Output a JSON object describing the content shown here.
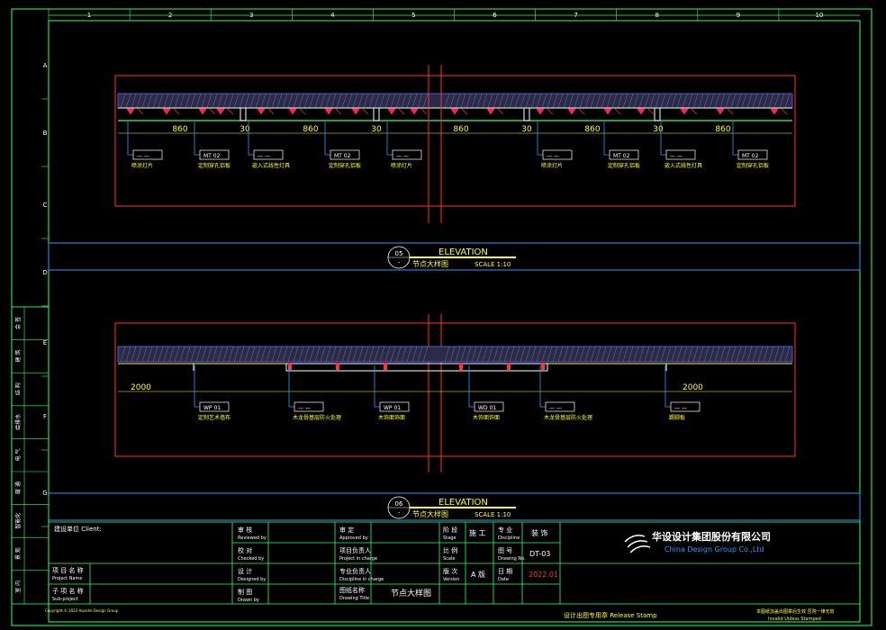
{
  "sheet": {
    "column_labels": [
      "1",
      "2",
      "3",
      "4",
      "5",
      "6",
      "7",
      "8",
      "9",
      "10"
    ],
    "row_labels": [
      "A",
      "B",
      "C",
      "D",
      "E",
      "F",
      "G"
    ]
  },
  "elevation_a": {
    "number": "05",
    "sub": "-",
    "title": "ELEVATION",
    "subtitle": "节点大样图",
    "scale": "SCALE 1:10",
    "dimensions": [
      "860",
      "30",
      "860",
      "30",
      "860",
      "30",
      "860",
      "30",
      "860"
    ],
    "tags": [
      {
        "code": "— —",
        "label": "喷涂灯片"
      },
      {
        "code": "MT 02",
        "label": "定制穿孔铝板"
      },
      {
        "code": "— —",
        "label": "嵌入式线性灯具"
      },
      {
        "code": "MT 02",
        "label": "定制穿孔铝板"
      },
      {
        "code": "— —",
        "label": "喷涂灯片"
      },
      {
        "code": "— —",
        "label": "喷涂灯片"
      },
      {
        "code": "MT 02",
        "label": "定制穿孔铝板"
      },
      {
        "code": "— —",
        "label": "嵌入式线性灯具"
      },
      {
        "code": "MT 02",
        "label": "定制穿孔铝板"
      }
    ]
  },
  "elevation_b": {
    "number": "06",
    "sub": "-",
    "title": "ELEVATION",
    "subtitle": "节点大样图",
    "scale": "SCALE 1:10",
    "dimensions": [
      "2000",
      "2000"
    ],
    "tags": [
      {
        "code": "WP 01",
        "label": "定制艺术墙布"
      },
      {
        "code": "— —",
        "label": "木龙骨基层防火处理"
      },
      {
        "code": "WP 01",
        "label": "木饰面饰面"
      },
      {
        "code": "WD 01",
        "label": "木饰面饰面"
      },
      {
        "code": "— —",
        "label": "木龙骨基层防火处理"
      },
      {
        "code": "— —",
        "label": "踢脚板"
      }
    ]
  },
  "title_block": {
    "client_label": "建设单位 Client:",
    "project_label": "项 目 名 称",
    "project_label_en": "Project Name",
    "subitem_label": "子 项 名 称",
    "subitem_label_en": "Sub-project",
    "cells": {
      "shenhe": "审 核",
      "shenhe_en": "Reviewed by",
      "jiaodui": "校 对",
      "jiaodui_en": "Checked by",
      "sheji": "设 计",
      "sheji_en": "Designed by",
      "zhitu": "制 图",
      "zhitu_en": "Drawn by",
      "shending": "审 定",
      "shending_en": "Approved by",
      "xiangmu_fuze": "项目负责人",
      "xiangmu_fuze_en": "Project in charge",
      "zhuanye_fuze": "专业负责人",
      "zhuanye_fuze_en": "Discipline in charge",
      "tuzhi_mingcheng": "图纸名称",
      "tuzhi_mingcheng_en": "Drawing Title",
      "drawing_title": "节点大样图",
      "jieduan": "阶 段",
      "jieduan_en": "Stage",
      "stage_value": "施 工",
      "zhuanye": "专 业",
      "zhuanye_en": "Discipline",
      "discipline_value": "装 饰",
      "bici": "比 例",
      "bici_en": "Scale",
      "tuhao": "图 号",
      "tuhao_en": "Drawing No.",
      "drawing_no": "DT-03",
      "banben": "版 次",
      "banben_en": "Version",
      "version_value": "A 版",
      "riqi": "日 期",
      "riqi_en": "Date",
      "date_value": "2022.01"
    },
    "company_cn": "华设设计集团股份有限公司",
    "company_en": "China Design Group Co.,Ltd",
    "stamp_label": "设计出图专用章  Release Stamp",
    "invalid_note": "本图纸加盖出图章后生效  否则一律无效",
    "invalid_note_en": "Invalid Unless Stamped",
    "copyright": "Copyright © 2022 Huashe Design Group"
  },
  "side_strip": {
    "cells": [
      "会 签",
      "建 筑",
      "结 构",
      "给排水",
      "电 气",
      "暖 通",
      "智能化",
      "景 观",
      "室 内"
    ]
  }
}
